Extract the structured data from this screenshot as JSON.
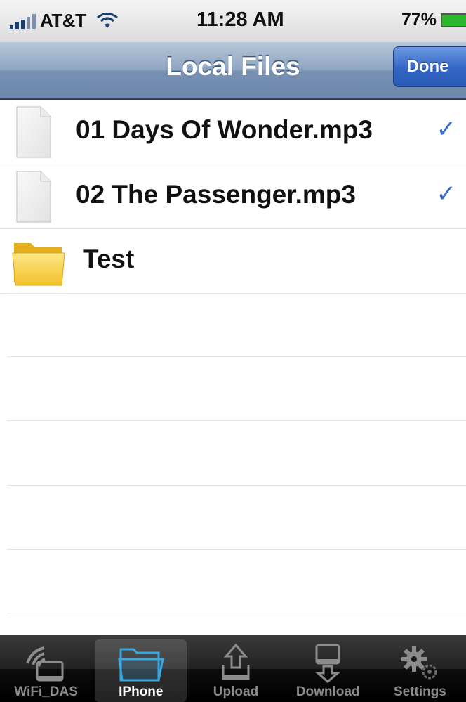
{
  "status_bar": {
    "carrier": "AT&T",
    "time": "11:28 AM",
    "battery": "77%"
  },
  "nav_bar": {
    "title": "Local Files",
    "done_label": "Done"
  },
  "files": [
    {
      "name": "01 Days Of Wonder.mp3",
      "type": "file",
      "checked": true,
      "check_mark": "✓"
    },
    {
      "name": "02 The Passenger.mp3",
      "type": "file",
      "checked": true,
      "check_mark": "✓"
    },
    {
      "name": "Test",
      "type": "folder",
      "checked": false
    }
  ],
  "tabs": [
    {
      "label": "WiFi_DAS",
      "icon": "wifi-drive-icon",
      "selected": false
    },
    {
      "label": "IPhone",
      "icon": "folder-icon",
      "selected": true
    },
    {
      "label": "Upload",
      "icon": "upload-icon",
      "selected": false
    },
    {
      "label": "Download",
      "icon": "download-icon",
      "selected": false
    },
    {
      "label": "Settings",
      "icon": "gears-icon",
      "selected": false
    }
  ],
  "colors": {
    "nav_bar": "#7891b3",
    "done_button": "#3265c5",
    "check_mark": "#3a6cc9",
    "folder": "#f5c93a",
    "tab_bar": "#1a1a1a"
  }
}
